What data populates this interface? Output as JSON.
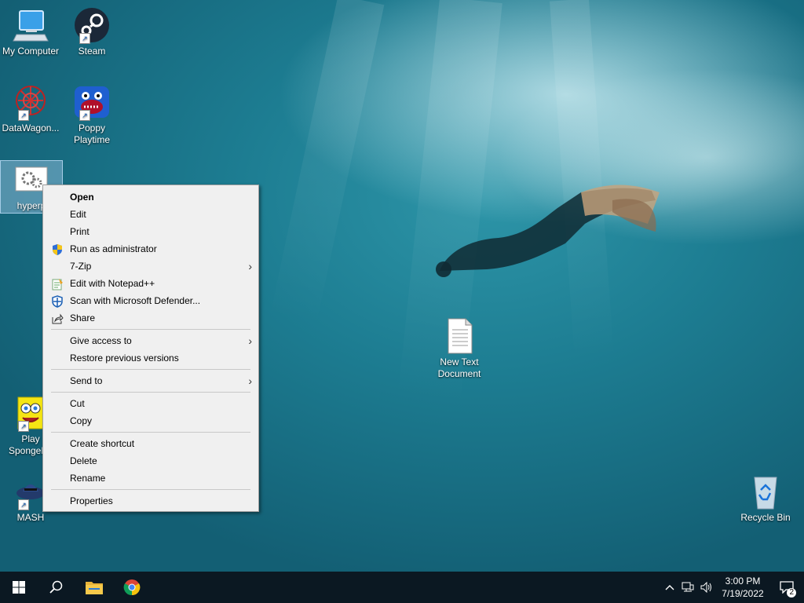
{
  "desktop": {
    "icons": [
      {
        "label": "My Computer"
      },
      {
        "label": "Steam"
      },
      {
        "label": "DataWagon..."
      },
      {
        "label": "Poppy Playtime"
      },
      {
        "label": "hyperp"
      },
      {
        "label": "Play SpongeBo"
      },
      {
        "label": "MASH"
      },
      {
        "label": "New Text Document"
      },
      {
        "label": "Recycle Bin"
      }
    ]
  },
  "context_menu": {
    "items": [
      {
        "label": "Open"
      },
      {
        "label": "Edit"
      },
      {
        "label": "Print"
      },
      {
        "label": "Run as administrator",
        "icon": "shield-icon"
      },
      {
        "label": "7-Zip"
      },
      {
        "label": "Edit with Notepad++",
        "icon": "notepadpp-icon"
      },
      {
        "label": "Scan with Microsoft Defender...",
        "icon": "defender-icon"
      },
      {
        "label": "Share",
        "icon": "share-icon"
      },
      {
        "label": "Give access to"
      },
      {
        "label": "Restore previous versions"
      },
      {
        "label": "Send to"
      },
      {
        "label": "Cut"
      },
      {
        "label": "Copy"
      },
      {
        "label": "Create shortcut"
      },
      {
        "label": "Delete"
      },
      {
        "label": "Rename"
      },
      {
        "label": "Properties"
      }
    ]
  },
  "taskbar": {
    "time": "3:00 PM",
    "date": "7/19/2022",
    "notification_count": "2"
  },
  "colors": {
    "taskbar_bg": "#0b1822",
    "menu_bg": "#f0f0f0",
    "water": "#1d7d92"
  }
}
